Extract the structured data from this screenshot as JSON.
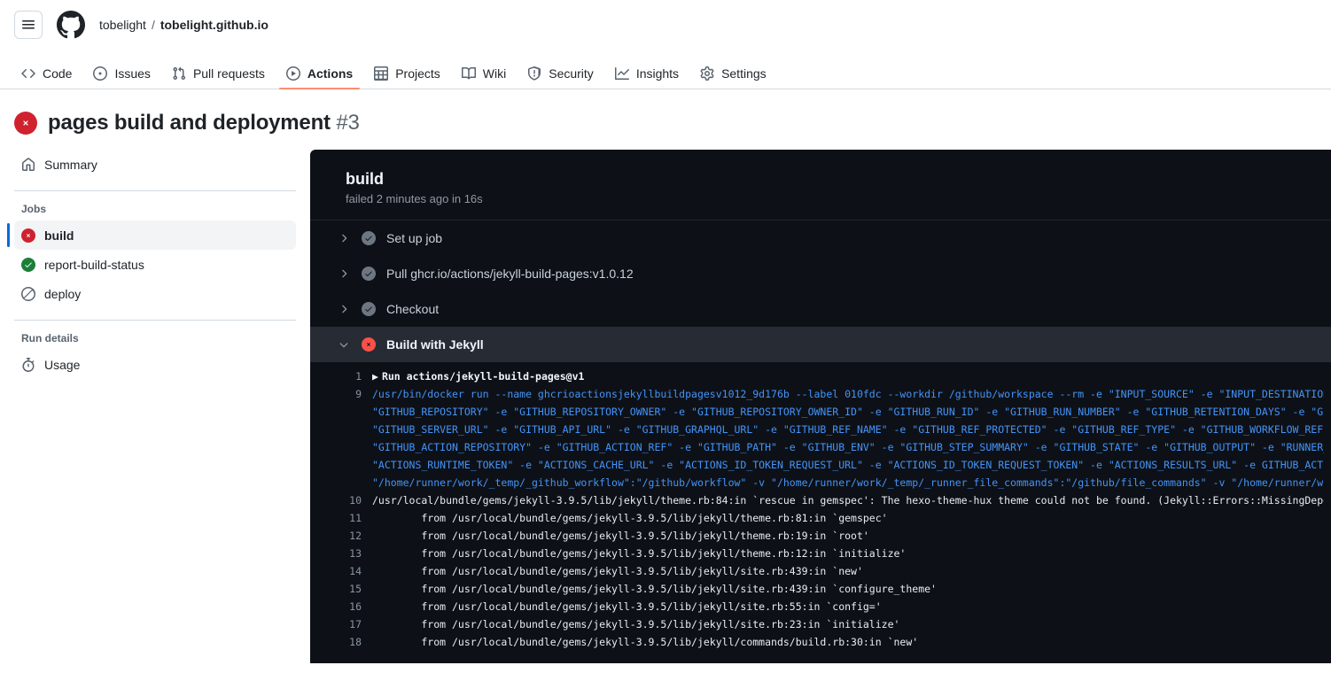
{
  "header": {
    "menu_icon": "hamburger-icon",
    "logo_icon": "github-mark-icon",
    "owner": "tobelight",
    "separator": "/",
    "repo": "tobelight.github.io"
  },
  "repo_nav": {
    "items": [
      {
        "label": "Code",
        "icon": "code-icon",
        "active": false
      },
      {
        "label": "Issues",
        "icon": "issue-opened-icon",
        "active": false
      },
      {
        "label": "Pull requests",
        "icon": "git-pull-request-icon",
        "active": false
      },
      {
        "label": "Actions",
        "icon": "play-icon",
        "active": true
      },
      {
        "label": "Projects",
        "icon": "table-icon",
        "active": false
      },
      {
        "label": "Wiki",
        "icon": "book-icon",
        "active": false
      },
      {
        "label": "Security",
        "icon": "shield-icon",
        "active": false
      },
      {
        "label": "Insights",
        "icon": "graph-icon",
        "active": false
      },
      {
        "label": "Settings",
        "icon": "gear-icon",
        "active": false
      }
    ],
    "active_underline_color": "#fd8c73"
  },
  "run": {
    "status_icon": "x-circle-fill-icon",
    "status_color": "#cf222e",
    "title": "pages build and deployment",
    "number": "#3"
  },
  "sidebar": {
    "summary": {
      "label": "Summary",
      "icon": "home-icon"
    },
    "jobs_heading": "Jobs",
    "jobs": [
      {
        "label": "build",
        "status": "failure",
        "icon": "x-circle-fill-icon",
        "selected": true
      },
      {
        "label": "report-build-status",
        "status": "success",
        "icon": "check-circle-fill-icon",
        "selected": false
      },
      {
        "label": "deploy",
        "status": "skipped",
        "icon": "skip-icon",
        "selected": false
      }
    ],
    "run_details_heading": "Run details",
    "usage": {
      "label": "Usage",
      "icon": "stopwatch-icon"
    }
  },
  "log_panel": {
    "job_name": "build",
    "job_status_text": "failed 2 minutes ago in 16s",
    "steps": [
      {
        "label": "Set up job",
        "status": "success",
        "expanded": false,
        "chevron": "chevron-right-icon"
      },
      {
        "label": "Pull ghcr.io/actions/jekyll-build-pages:v1.0.12",
        "status": "success",
        "expanded": false,
        "chevron": "chevron-right-icon"
      },
      {
        "label": "Checkout",
        "status": "success",
        "expanded": false,
        "chevron": "chevron-right-icon"
      },
      {
        "label": "Build with Jekyll",
        "status": "failure",
        "expanded": true,
        "chevron": "chevron-down-icon"
      }
    ],
    "lines": [
      {
        "n": "1",
        "style": "head",
        "marker": "▶",
        "text": "Run actions/jekyll-build-pages@v1"
      },
      {
        "n": "9",
        "style": "blue",
        "text": "/usr/bin/docker run --name ghcrioactionsjekyllbuildpagesv1012_9d176b --label 010fdc --workdir /github/workspace --rm -e \"INPUT_SOURCE\" -e \"INPUT_DESTINATION\" -e \"I"
      },
      {
        "n": "",
        "style": "blue",
        "text": "\"GITHUB_REPOSITORY\" -e \"GITHUB_REPOSITORY_OWNER\" -e \"GITHUB_REPOSITORY_OWNER_ID\" -e \"GITHUB_RUN_ID\" -e \"GITHUB_RUN_NUMBER\" -e \"GITHUB_RETENTION_DAYS\" -e \"GITHUB_RU"
      },
      {
        "n": "",
        "style": "blue",
        "text": "\"GITHUB_SERVER_URL\" -e \"GITHUB_API_URL\" -e \"GITHUB_GRAPHQL_URL\" -e \"GITHUB_REF_NAME\" -e \"GITHUB_REF_PROTECTED\" -e \"GITHUB_REF_TYPE\" -e \"GITHUB_WORKFLOW_REF\" -e \"GI"
      },
      {
        "n": "",
        "style": "blue",
        "text": "\"GITHUB_ACTION_REPOSITORY\" -e \"GITHUB_ACTION_REF\" -e \"GITHUB_PATH\" -e \"GITHUB_ENV\" -e \"GITHUB_STEP_SUMMARY\" -e \"GITHUB_STATE\" -e \"GITHUB_OUTPUT\" -e \"RUNNER_OS\" -e"
      },
      {
        "n": "",
        "style": "blue",
        "text": "\"ACTIONS_RUNTIME_TOKEN\" -e \"ACTIONS_CACHE_URL\" -e \"ACTIONS_ID_TOKEN_REQUEST_URL\" -e \"ACTIONS_ID_TOKEN_REQUEST_TOKEN\" -e \"ACTIONS_RESULTS_URL\" -e GITHUB_ACTIONS=tru"
      },
      {
        "n": "",
        "style": "blue",
        "text": "\"/home/runner/work/_temp/_github_workflow\":\"/github/workflow\" -v \"/home/runner/work/_temp/_runner_file_commands\":\"/github/file_commands\" -v \"/home/runner/work/tobe"
      },
      {
        "n": "10",
        "style": "white",
        "text": "/usr/local/bundle/gems/jekyll-3.9.5/lib/jekyll/theme.rb:84:in `rescue in gemspec': The hexo-theme-hux theme could not be found. (Jekyll::Errors::MissingDependency"
      },
      {
        "n": "11",
        "style": "white",
        "text": "        from /usr/local/bundle/gems/jekyll-3.9.5/lib/jekyll/theme.rb:81:in `gemspec'"
      },
      {
        "n": "12",
        "style": "white",
        "text": "        from /usr/local/bundle/gems/jekyll-3.9.5/lib/jekyll/theme.rb:19:in `root'"
      },
      {
        "n": "13",
        "style": "white",
        "text": "        from /usr/local/bundle/gems/jekyll-3.9.5/lib/jekyll/theme.rb:12:in `initialize'"
      },
      {
        "n": "14",
        "style": "white",
        "text": "        from /usr/local/bundle/gems/jekyll-3.9.5/lib/jekyll/site.rb:439:in `new'"
      },
      {
        "n": "15",
        "style": "white",
        "text": "        from /usr/local/bundle/gems/jekyll-3.9.5/lib/jekyll/site.rb:439:in `configure_theme'"
      },
      {
        "n": "16",
        "style": "white",
        "text": "        from /usr/local/bundle/gems/jekyll-3.9.5/lib/jekyll/site.rb:55:in `config='"
      },
      {
        "n": "17",
        "style": "white",
        "text": "        from /usr/local/bundle/gems/jekyll-3.9.5/lib/jekyll/site.rb:23:in `initialize'"
      },
      {
        "n": "18",
        "style": "white",
        "text": "        from /usr/local/bundle/gems/jekyll-3.9.5/lib/jekyll/commands/build.rb:30:in `new'"
      }
    ]
  },
  "colors": {
    "accent_blue": "#0969da",
    "danger_red": "#cf222e",
    "success_green": "#1a7f37",
    "log_bg": "#0d1117",
    "log_blue": "#4493f8"
  }
}
